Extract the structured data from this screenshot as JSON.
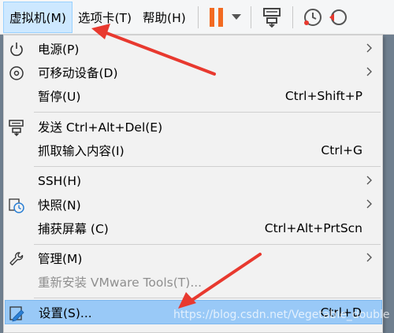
{
  "menubar": {
    "items": [
      {
        "label": "虚拟机(M)"
      },
      {
        "label": "选项卡(T)"
      },
      {
        "label": "帮助(H)"
      }
    ],
    "icons": [
      "pause-icon",
      "dropdown-arrow-icon",
      "send-keys-icon",
      "snapshot-icon",
      "revert-icon"
    ]
  },
  "menu": {
    "items": [
      {
        "label": "电源(P)",
        "shortcut": "",
        "submenu": true,
        "icon": "power-icon"
      },
      {
        "label": "可移动设备(D)",
        "shortcut": "",
        "submenu": true,
        "icon": "removable-device-icon"
      },
      {
        "label": "暂停(U)",
        "shortcut": "Ctrl+Shift+P",
        "submenu": false,
        "icon": ""
      },
      {
        "label": "发送 Ctrl+Alt+Del(E)",
        "shortcut": "",
        "submenu": false,
        "icon": "send-keys-icon"
      },
      {
        "label": "抓取输入内容(I)",
        "shortcut": "Ctrl+G",
        "submenu": false,
        "icon": ""
      },
      {
        "label": "SSH(H)",
        "shortcut": "",
        "submenu": true,
        "icon": ""
      },
      {
        "label": "快照(N)",
        "shortcut": "",
        "submenu": true,
        "icon": "snapshot-icon"
      },
      {
        "label": "捕获屏幕 (C)",
        "shortcut": "Ctrl+Alt+PrtScn",
        "submenu": false,
        "icon": ""
      },
      {
        "label": "管理(M)",
        "shortcut": "",
        "submenu": true,
        "icon": "wrench-icon"
      },
      {
        "label": "重新安装 VMware Tools(T)...",
        "shortcut": "",
        "submenu": false,
        "disabled": true,
        "icon": ""
      },
      {
        "label": "设置(S)...",
        "shortcut": "Ctrl+D",
        "submenu": false,
        "selected": true,
        "icon": "settings-icon"
      }
    ]
  },
  "watermark": "https://blog.csdn.net/Vegetable_double",
  "colors": {
    "accent": "#e8392f",
    "pause": "#f26a21",
    "selected": "#99c9f7"
  }
}
